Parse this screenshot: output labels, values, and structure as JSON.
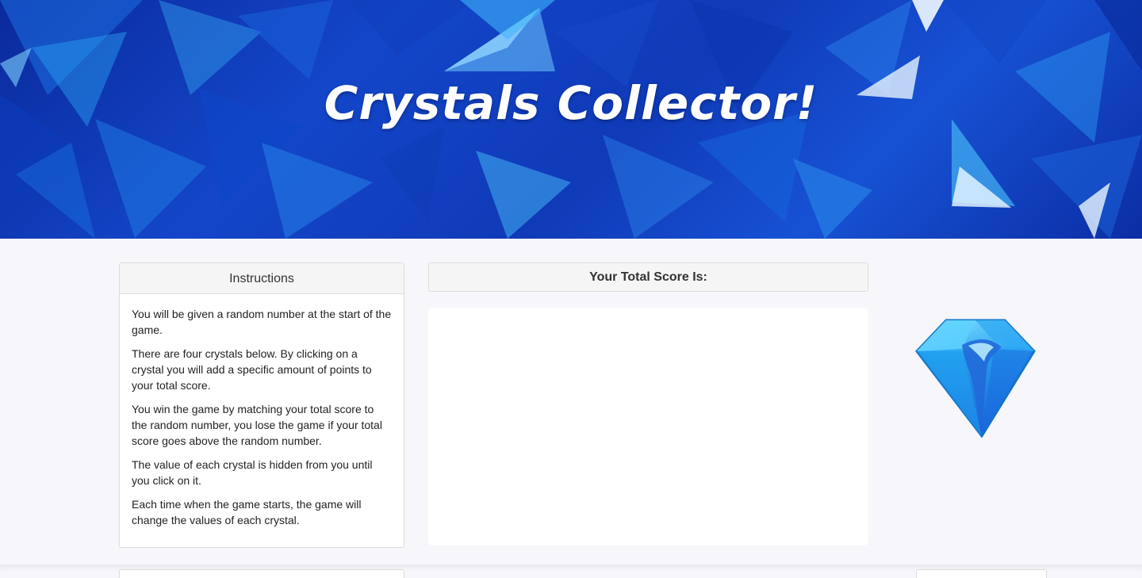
{
  "header": {
    "title": "Crystals Collector!"
  },
  "instructions": {
    "heading": "Instructions",
    "paragraphs": [
      "You will be given a random number at the start of the game.",
      "There are four crystals below. By clicking on a crystal you will add a specific amount of points to your total score.",
      "You win the game by matching your total score to the random number, you lose the game if your total score goes above the random number.",
      "The value of each crystal is hidden from you until you click on it.",
      "Each time when the game starts, the game will change the values of each crystal."
    ]
  },
  "score": {
    "heading": "Your Total Score Is:",
    "value": ""
  },
  "crystal": {
    "icon": "blue-diamond-icon",
    "color": "#1e9cf0"
  },
  "colors": {
    "banner_dark": "#0b2da4",
    "banner_light": "#1f8cf0",
    "page_background": "#f6f6fb"
  }
}
